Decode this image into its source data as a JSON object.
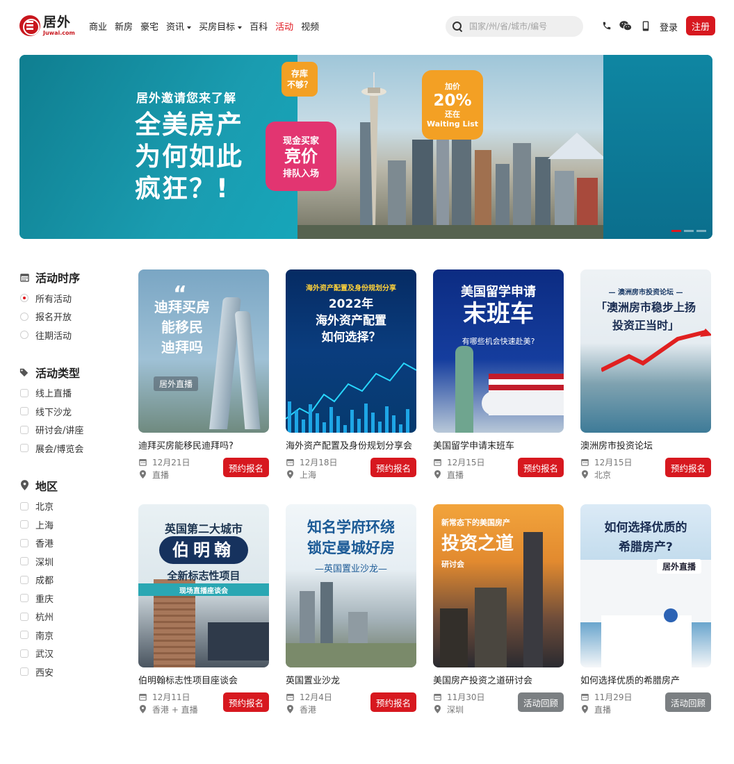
{
  "header": {
    "logo_cn": "居外",
    "logo_en": "Juwai.com",
    "nav": [
      {
        "label": "商业",
        "caret": false,
        "active": false
      },
      {
        "label": "新房",
        "caret": false,
        "active": false
      },
      {
        "label": "豪宅",
        "caret": false,
        "active": false
      },
      {
        "label": "资讯",
        "caret": true,
        "active": false
      },
      {
        "label": "买房目标",
        "caret": true,
        "active": false
      },
      {
        "label": "百科",
        "caret": false,
        "active": false
      },
      {
        "label": "活动",
        "caret": false,
        "active": true
      },
      {
        "label": "视频",
        "caret": false,
        "active": false
      }
    ],
    "search_placeholder": "国家/州/省/城市/编号",
    "login": "登录",
    "register": "注册"
  },
  "banner": {
    "subtitle": "居外邀请您来了解",
    "title_lines": [
      "全美房产",
      "为何如此",
      "疯狂？!"
    ],
    "bubble_pink": [
      "现金买家",
      "竞价",
      "排队入场"
    ],
    "bubble_orange_small": [
      "存库",
      "不够？"
    ],
    "bubble_orange_big": [
      "加价",
      "20%",
      "还在",
      "Waiting List"
    ],
    "slides": 3,
    "active_slide": 0
  },
  "sidebar": {
    "groups": [
      {
        "title": "活动时序",
        "icon": "calendar-icon",
        "type": "radio",
        "options": [
          {
            "label": "所有活动",
            "checked": true
          },
          {
            "label": "报名开放",
            "checked": false
          },
          {
            "label": "往期活动",
            "checked": false
          }
        ]
      },
      {
        "title": "活动类型",
        "icon": "tags-icon",
        "type": "checkbox",
        "options": [
          {
            "label": "线上直播"
          },
          {
            "label": "线下沙龙"
          },
          {
            "label": "研讨会/讲座"
          },
          {
            "label": "展会/博览会"
          }
        ]
      },
      {
        "title": "地区",
        "icon": "map-pin-icon",
        "type": "checkbox",
        "options": [
          {
            "label": "北京"
          },
          {
            "label": "上海"
          },
          {
            "label": "香港"
          },
          {
            "label": "深圳"
          },
          {
            "label": "成都"
          },
          {
            "label": "重庆"
          },
          {
            "label": "杭州"
          },
          {
            "label": "南京"
          },
          {
            "label": "武汉"
          },
          {
            "label": "西安"
          }
        ]
      }
    ]
  },
  "events": [
    {
      "title": "迪拜买房能移民迪拜吗?",
      "date": "12月21日",
      "location": "直播",
      "button": "预约报名",
      "status": "open",
      "thumb_lines": [
        "迪拜买房",
        "能移民",
        "迪拜吗"
      ],
      "thumb_tag": "居外直播",
      "thumb_theme": "dubai"
    },
    {
      "title": "海外资产配置及身份规划分享会",
      "date": "12月18日",
      "location": "上海",
      "button": "预约报名",
      "status": "open",
      "thumb_lines": [
        "海外资产配置及身份规划分享",
        "2022年",
        "海外资产配置",
        "如何选择？"
      ],
      "thumb_tag": "",
      "thumb_theme": "finance"
    },
    {
      "title": "美国留学申请末班车",
      "date": "12月15日",
      "location": "直播",
      "button": "预约报名",
      "status": "open",
      "thumb_lines": [
        "美国留学申请",
        "末班车",
        "有哪些机会快速赴美?"
      ],
      "thumb_tag": "",
      "thumb_theme": "usa"
    },
    {
      "title": "澳洲房市投资论坛",
      "date": "12月15日",
      "location": "北京",
      "button": "预约报名",
      "status": "open",
      "thumb_lines": [
        "— 澳洲房市投资论坛 —",
        "「澳洲房市稳步上扬",
        "投资正当时」"
      ],
      "thumb_tag": "",
      "thumb_theme": "australia"
    },
    {
      "title": "伯明翰标志性项目座谈会",
      "date": "12月11日",
      "location": "香港 + 直播",
      "button": "预约报名",
      "status": "open",
      "thumb_lines": [
        "英国第二大城市",
        "伯明翰",
        "全新标志性项目",
        "现场直播座谈会"
      ],
      "thumb_tag": "",
      "thumb_theme": "birmingham"
    },
    {
      "title": "英国置业沙龙",
      "date": "12月4日",
      "location": "香港",
      "button": "预约报名",
      "status": "open",
      "thumb_lines": [
        "知名学府环绕",
        "锁定曼城好房",
        "—英国置业沙龙—"
      ],
      "thumb_tag": "",
      "thumb_theme": "manchester"
    },
    {
      "title": "美国房产投资之道研讨会",
      "date": "11月30日",
      "location": "深圳",
      "button": "活动回顾",
      "status": "replay",
      "thumb_lines": [
        "新常态下的美国房产",
        "投资之道",
        "研讨会"
      ],
      "thumb_tag": "",
      "thumb_theme": "nyc"
    },
    {
      "title": "如何选择优质的希腊房产",
      "date": "11月29日",
      "location": "直播",
      "button": "活动回顾",
      "status": "replay",
      "thumb_lines": [
        "如何选择优质的",
        "希腊房产?"
      ],
      "thumb_tag": "居外直播",
      "thumb_theme": "greece"
    }
  ],
  "colors": {
    "accent": "#d7181f",
    "replay": "#7b7f82",
    "active_nav": "#e0161e"
  }
}
